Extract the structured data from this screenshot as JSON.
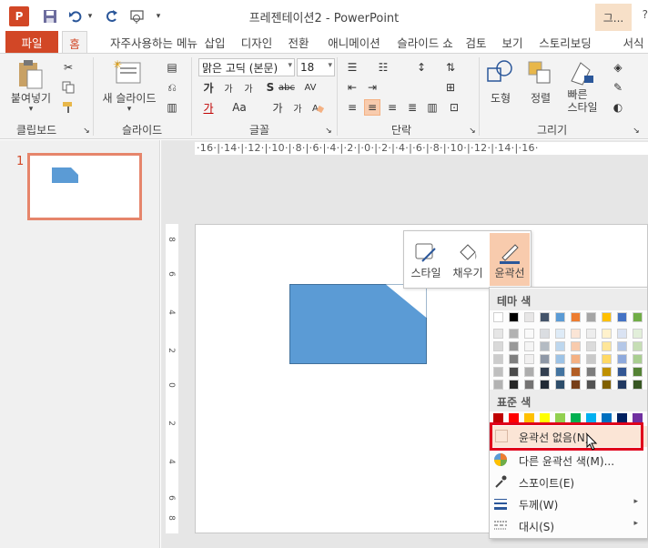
{
  "app": {
    "logo_letter": "P",
    "title": "프레젠테이션2 - PowerPoint",
    "tool_tab": "그...",
    "help_glyph": "?",
    "qat": {
      "save_glyph": "💾",
      "undo_glyph": "↶",
      "redo_glyph": "↻",
      "more_glyph": "▾"
    }
  },
  "tabs": [
    {
      "label": "파일",
      "state": "file"
    },
    {
      "label": "홈",
      "state": "active"
    },
    {
      "label": "자주사용하는 메뉴"
    },
    {
      "label": "삽입"
    },
    {
      "label": "디자인"
    },
    {
      "label": "전환"
    },
    {
      "label": "애니메이션"
    },
    {
      "label": "슬라이드 쇼"
    },
    {
      "label": "검토"
    },
    {
      "label": "보기"
    },
    {
      "label": "스토리보딩"
    },
    {
      "label": "서식"
    }
  ],
  "ribbon": {
    "clipboard": {
      "label": "클립보드",
      "paste": "붙여넣기"
    },
    "slides": {
      "label": "슬라이드",
      "new_slide": "새 슬라이드"
    },
    "font": {
      "label": "글꼴",
      "font_name": "맑은 고딕 (본문)",
      "font_size": "18",
      "grow": "가",
      "shrink": "가",
      "clear": "가",
      "bold": "가",
      "italic": "가",
      "underline": "가",
      "shadow": "S",
      "strike": "abc",
      "spacing": "AV",
      "case": "Aa",
      "highlight": "가",
      "color_a": "가",
      "color_b": "가",
      "color_c": "가"
    },
    "paragraph": {
      "label": "단락"
    },
    "drawing": {
      "label": "그리기",
      "shapes": "도형",
      "arrange": "정렬",
      "quick_styles": "빠른\n스타일"
    }
  },
  "ruler": {
    "marks": "·16·|·14·|·12·|·10·|·8·|·6·|·4·|·2·|·0·|·2·|·4·|·6·|·8·|·10·|·12·|·14·|·16·"
  },
  "vruler": [
    "8",
    "6",
    "4",
    "2",
    "0",
    "2",
    "4",
    "6",
    "8"
  ],
  "thumbnails": {
    "slide_number": "1"
  },
  "mini_toolbar": {
    "style": "스타일",
    "fill": "채우기",
    "outline": "윤곽선"
  },
  "menu": {
    "theme_colors_header": "테마 색",
    "standard_colors_header": "표준 색",
    "no_outline": "윤곽선 없음(N)",
    "more_colors": "다른 윤곽선 색(M)...",
    "eyedropper": "스포이트(E)",
    "weight": "두께(W)",
    "dashes": "대시(S)",
    "submenu_arrow": "▸"
  },
  "colors": {
    "accent": "#d24726",
    "shape_fill": "#5b9bd5",
    "highlight_outline": "#e0001b",
    "theme_row": [
      "#ffffff",
      "#000000",
      "#e7e6e6",
      "#44546a",
      "#5b9bd5",
      "#ed7d31",
      "#a5a5a5",
      "#ffc000",
      "#4472c4",
      "#70ad47"
    ],
    "standard_row": [
      "#c00000",
      "#ff0000",
      "#ffc000",
      "#ffff00",
      "#92d050",
      "#00b050",
      "#00b0f0",
      "#0070c0",
      "#002060",
      "#7030a0"
    ]
  }
}
